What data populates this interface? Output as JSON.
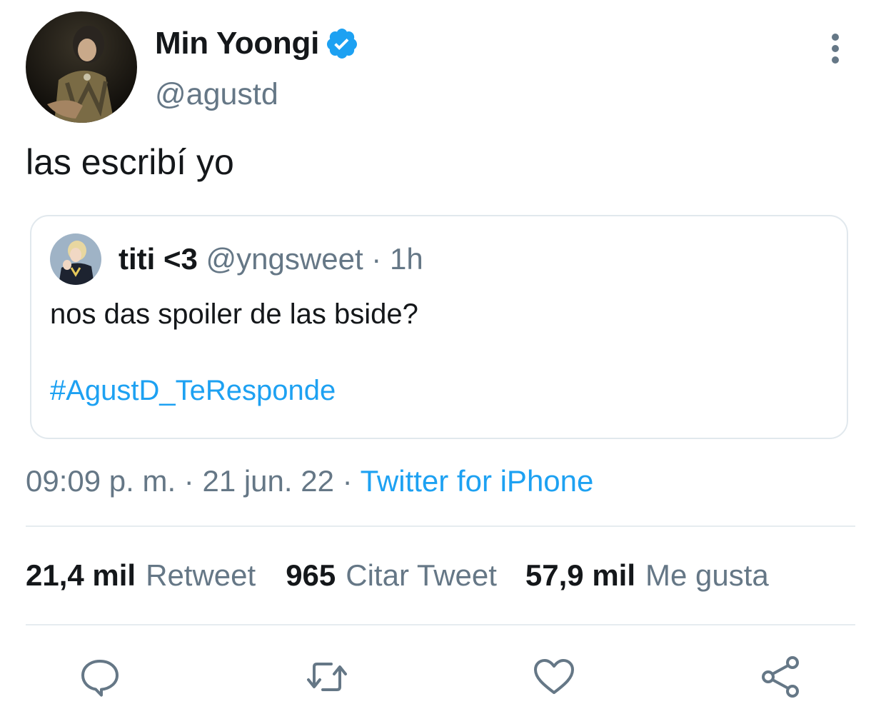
{
  "tweet": {
    "author": {
      "display_name": "Min Yoongi",
      "handle": "@agustd",
      "verified": true
    },
    "text": "las escribí yo",
    "quoted": {
      "display_name": "titi <3",
      "handle": "@yngsweet",
      "separator": "·",
      "time": "1h",
      "text": "nos das spoiler de las bside?",
      "hashtag": "#AgustD_TeResponde"
    },
    "meta": {
      "time": "09:09 p. m.",
      "sep1": "·",
      "date": "21 jun. 22",
      "sep2": "·",
      "source": "Twitter for iPhone"
    },
    "stats": [
      {
        "count": "21,4 mil",
        "label": "Retweet"
      },
      {
        "count": "965",
        "label": "Citar Tweet"
      },
      {
        "count": "57,9 mil",
        "label": "Me gusta"
      }
    ],
    "actions": [
      "reply-icon",
      "retweet-icon",
      "like-icon",
      "share-icon"
    ]
  },
  "colors": {
    "accent": "#1da1f2",
    "secondary_text": "#657786",
    "primary_text": "#14171a",
    "border": "#e1e8ed"
  }
}
